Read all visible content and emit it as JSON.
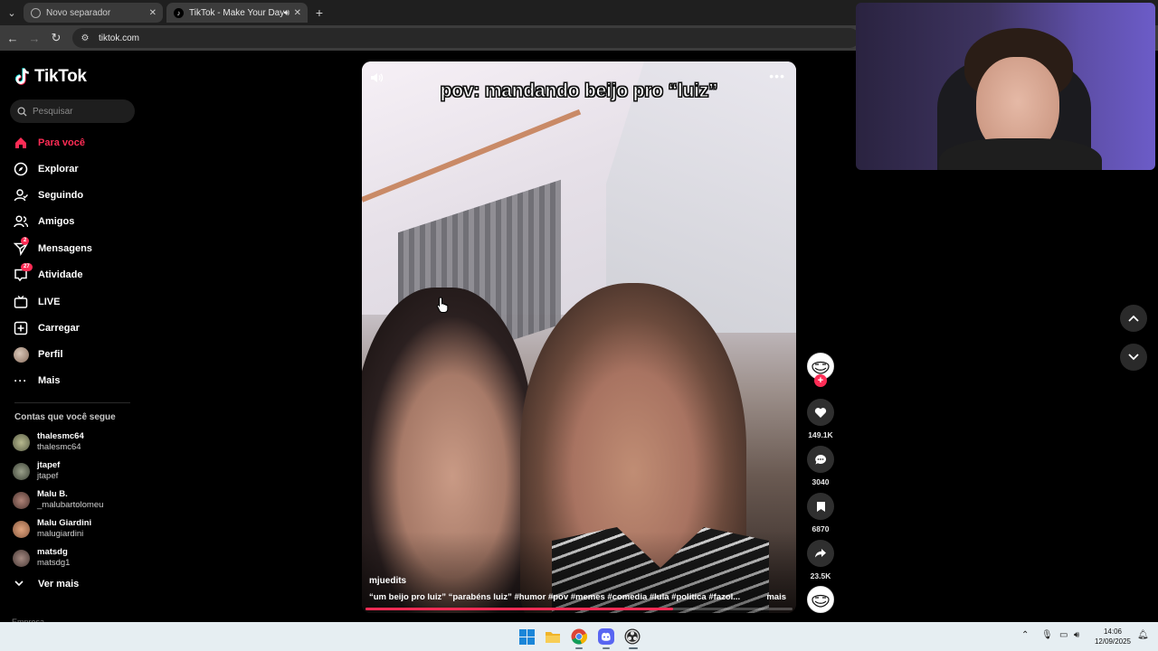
{
  "browser": {
    "tabs": [
      {
        "title": "Novo separador",
        "active": false
      },
      {
        "title": "TikTok - Make Your Day",
        "active": true
      }
    ],
    "url": "tiktok.com"
  },
  "sidebar": {
    "logo": "TikTok",
    "search_placeholder": "Pesquisar",
    "nav": [
      {
        "label": "Para você",
        "icon": "home-icon",
        "active": true
      },
      {
        "label": "Explorar",
        "icon": "compass-icon"
      },
      {
        "label": "Seguindo",
        "icon": "following-icon"
      },
      {
        "label": "Amigos",
        "icon": "friends-icon"
      },
      {
        "label": "Mensagens",
        "icon": "messages-icon",
        "badge": "2"
      },
      {
        "label": "Atividade",
        "icon": "activity-icon",
        "badge": "27"
      },
      {
        "label": "LIVE",
        "icon": "live-icon"
      },
      {
        "label": "Carregar",
        "icon": "upload-icon"
      },
      {
        "label": "Perfil",
        "icon": "profile-avatar"
      },
      {
        "label": "Mais",
        "icon": "more-icon"
      }
    ],
    "following_heading": "Contas que você segue",
    "accounts": [
      {
        "name": "thalesmc64",
        "handle": "thalesmc64",
        "color": "#8b8f73"
      },
      {
        "name": "jtapef",
        "handle": "jtapef",
        "color": "#5f6a55"
      },
      {
        "name": "Malu B.",
        "handle": "_malubartolomeu",
        "color": "#7a5a50"
      },
      {
        "name": "Malu Giardini",
        "handle": "malugiardini",
        "color": "#a8755a"
      },
      {
        "name": "matsdg",
        "handle": "matsdg1",
        "color": "#6f5e58"
      }
    ],
    "see_more": "Ver mais",
    "footer_partial": "Empresa"
  },
  "video": {
    "overlay_caption": "pov: mandando beijo pro “luiz”",
    "author": "mjuedits",
    "description": "“um beijo pro luiz” “parabéns luiz” #humor #pov #memes #comedia #lula #politica #fazol...",
    "more_label": "mais",
    "progress": 0.72
  },
  "actions": {
    "likes": "149.1K",
    "comments": "3040",
    "saves": "6870",
    "shares": "23.5K"
  },
  "taskbar": {
    "time": "14:06",
    "date": "12/09/2025"
  }
}
